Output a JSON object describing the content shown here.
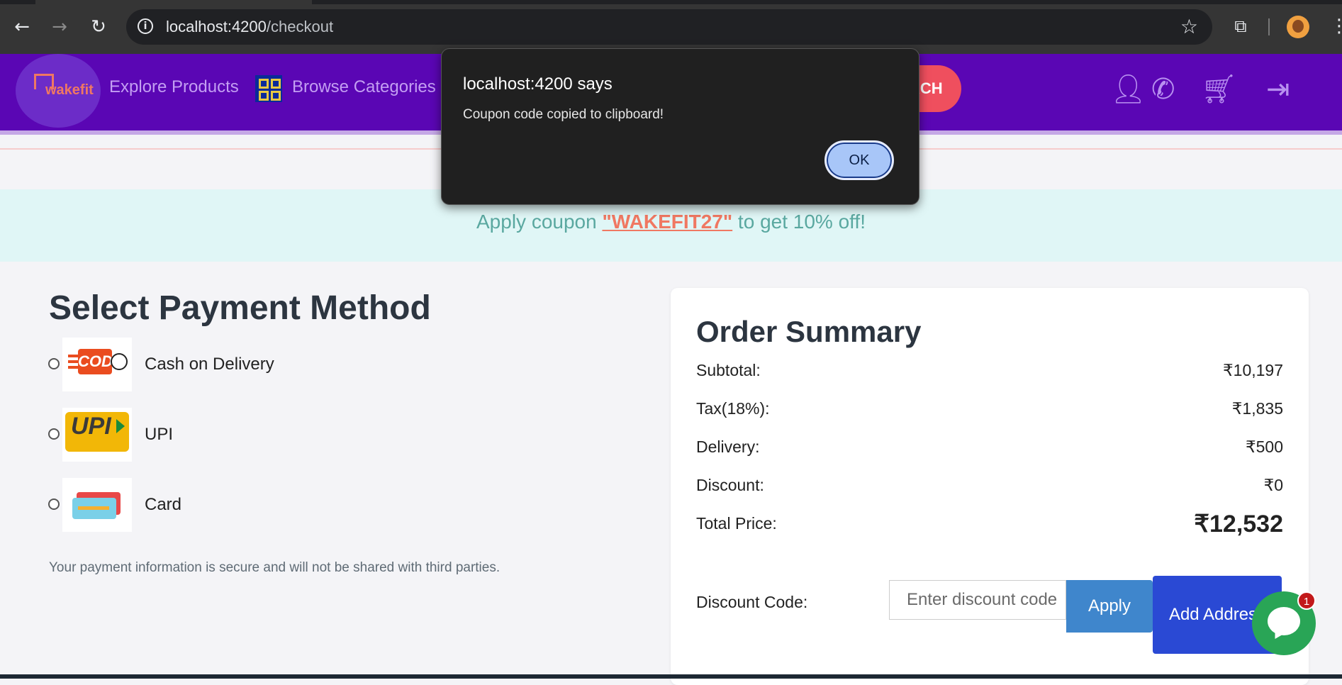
{
  "browser": {
    "url_host": "localhost:4200",
    "url_path": "/checkout",
    "icons": [
      "back-arrow-icon",
      "forward-arrow-icon",
      "reload-icon",
      "site-info-icon",
      "bookmark-star-icon",
      "extensions-icon",
      "profile-avatar",
      "menu-icon"
    ]
  },
  "header": {
    "logo_text": "wakefit",
    "explore_label": "Explore Products",
    "categories_label": "Browse Categories",
    "search_label": "RCH",
    "icons": [
      "user-icon",
      "phone-icon",
      "cart-icon",
      "login-icon"
    ],
    "colors": {
      "bg": "#5a06b4",
      "link": "#c39ef2",
      "search_btn": "#ef4f5e"
    }
  },
  "banner": {
    "prefix": "Apply coupon ",
    "code": "\"WAKEFIT27\"",
    "suffix": " to get 10% off!"
  },
  "payment": {
    "title": "Select Payment Method",
    "options": [
      {
        "label": "Cash on Delivery",
        "icon": "cod-logo",
        "logo_text": "COD"
      },
      {
        "label": "UPI",
        "icon": "upi-logo",
        "logo_text": "UPI"
      },
      {
        "label": "Card",
        "icon": "card-logo"
      }
    ],
    "secure_note": "Your payment information is secure and will not be shared with third parties."
  },
  "summary": {
    "title": "Order Summary",
    "rows": [
      {
        "label": "Subtotal:",
        "value": "₹10,197"
      },
      {
        "label": "Tax(18%):",
        "value": "₹1,835"
      },
      {
        "label": "Delivery:",
        "value": "₹500"
      },
      {
        "label": "Discount:",
        "value": "₹0"
      },
      {
        "label": "Total Price:",
        "value": "₹12,532"
      }
    ],
    "discount_label": "Discount Code:",
    "discount_placeholder": "Enter discount code",
    "apply_label": "Apply",
    "address_label": "Add Address"
  },
  "chat": {
    "badge_count": "1",
    "color": "#29a556"
  },
  "dialog": {
    "title": "localhost:4200 says",
    "message": "Coupon code copied to clipboard!",
    "ok_label": "OK"
  }
}
